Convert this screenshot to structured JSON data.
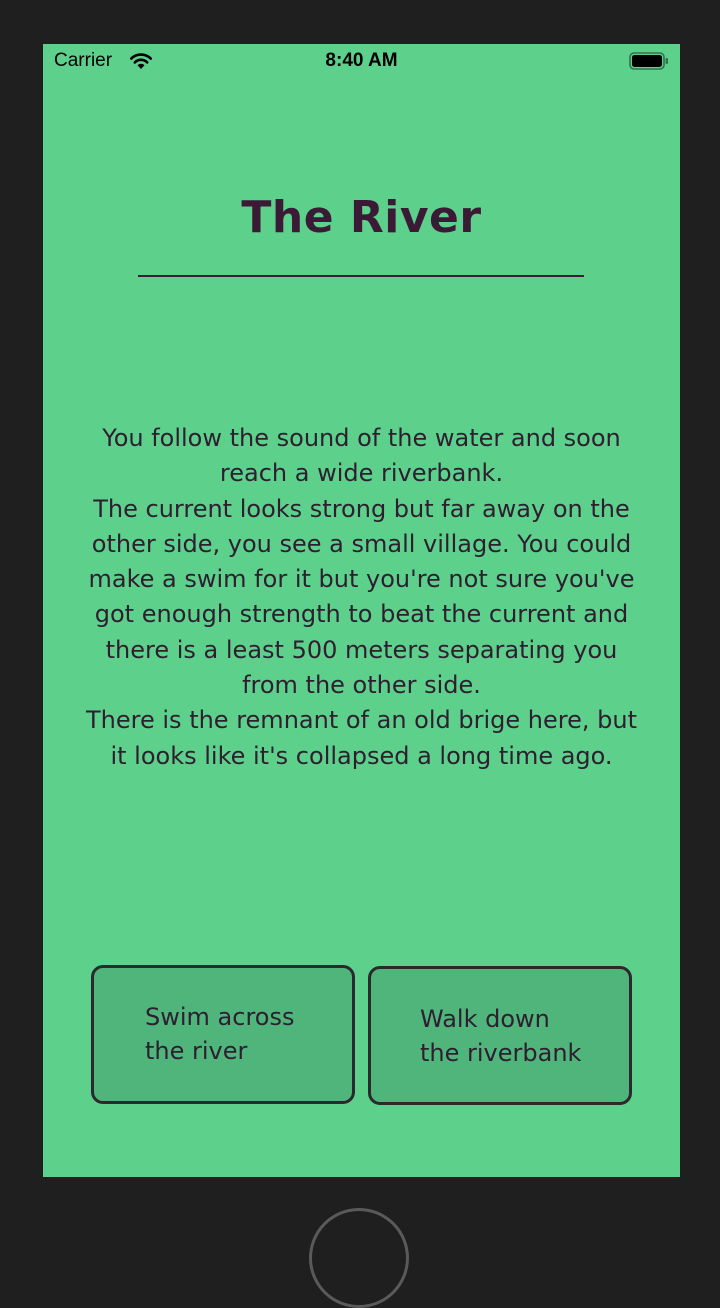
{
  "status_bar": {
    "carrier": "Carrier",
    "time": "8:40 AM",
    "wifi_icon": "wifi-icon",
    "battery_icon": "battery-icon"
  },
  "screen": {
    "background_color": "#5dd08c",
    "title": "The River",
    "story": "You follow the sound of the water and soon reach a wide riverbank.\nThe current looks strong but far away on the other side, you see a small village. You could make a swim for it but you're not sure you've got enough strength to beat the current and there is a least 500 meters separating you from the other side.\nThere is the remnant of an old brige here, but it looks like it's collapsed a long time ago."
  },
  "choices": {
    "left_label": "Swim across\nthe river",
    "right_label": "Walk down\nthe riverbank",
    "button_color": "#4fb57b",
    "border_color": "#2a2a2e"
  },
  "colors": {
    "text": "#2e1e30",
    "title": "#3a1a35"
  }
}
